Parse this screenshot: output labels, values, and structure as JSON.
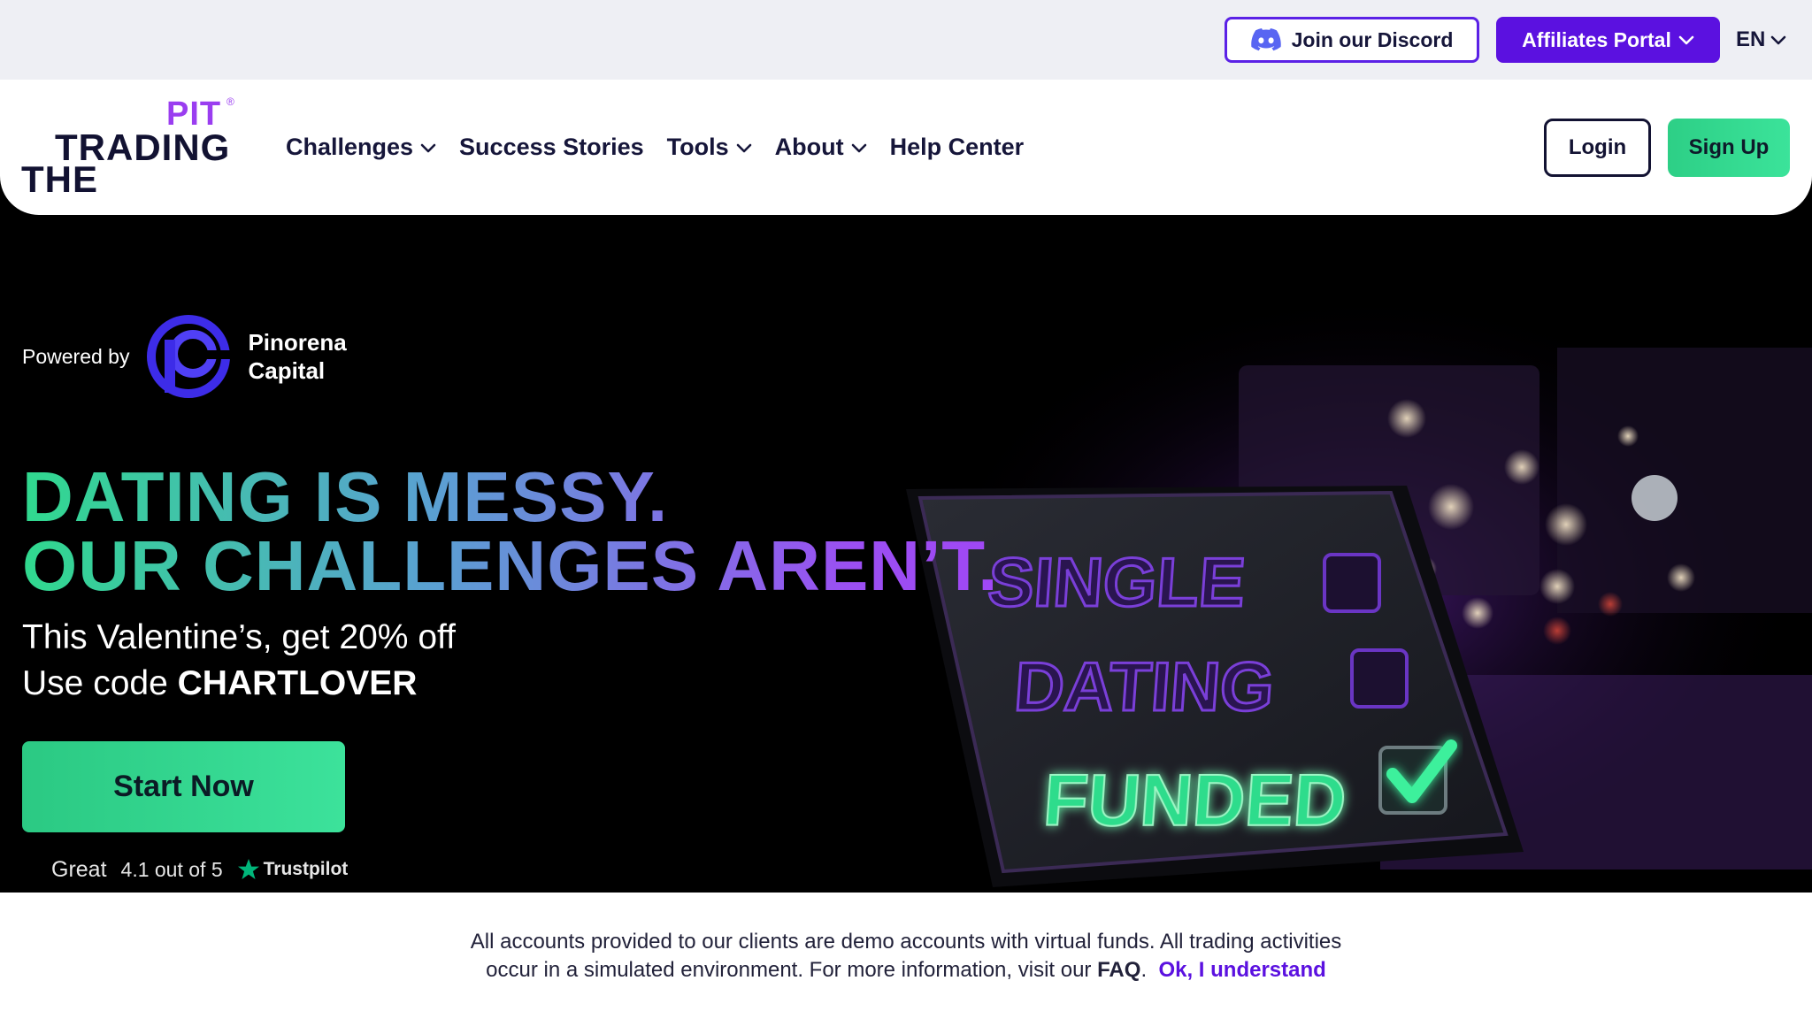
{
  "topbar": {
    "discord_label": "Join our Discord",
    "affiliates_label": "Affiliates Portal",
    "language": "EN"
  },
  "logo": {
    "line1": "PIT",
    "line2": "TRADING",
    "line3": "THE",
    "registered": "®"
  },
  "nav": {
    "items": [
      {
        "label": "Challenges",
        "dropdown": true
      },
      {
        "label": "Success Stories",
        "dropdown": false
      },
      {
        "label": "Tools",
        "dropdown": true
      },
      {
        "label": "About",
        "dropdown": true
      },
      {
        "label": "Help Center",
        "dropdown": false
      }
    ],
    "login_label": "Login",
    "signup_label": "Sign Up"
  },
  "hero": {
    "powered_by": "Powered by",
    "partner_line1": "Pinorena",
    "partner_line2": "Capital",
    "headline_line1": "DATING IS MESSY.",
    "headline_line2": "OUR CHALLENGES AREN’T.",
    "promo_line1": "This Valentine’s, get 20% off",
    "promo_line2_prefix": "Use code ",
    "promo_code": "CHARTLOVER",
    "cta_label": "Start Now",
    "tablet_options": [
      "SINGLE",
      "DATING",
      "FUNDED"
    ],
    "tablet_checked": "FUNDED"
  },
  "trustpilot": {
    "rating_word": "Great",
    "score_text": "4.1 out of 5",
    "brand": "Trustpilot",
    "star_color": "#00b67a"
  },
  "notice": {
    "line1": "All accounts provided to our clients are demo accounts with virtual funds. All trading activities",
    "line2_prefix": "occur in a simulated environment. For more information, visit our ",
    "faq_label": "FAQ",
    "line2_suffix": ".",
    "ok_label": "Ok, I understand"
  },
  "colors": {
    "brand_purple": "#5b11e0",
    "brand_green": "#2dcf86",
    "logo_purple": "#9a3df0",
    "navy_text": "#16163a"
  }
}
